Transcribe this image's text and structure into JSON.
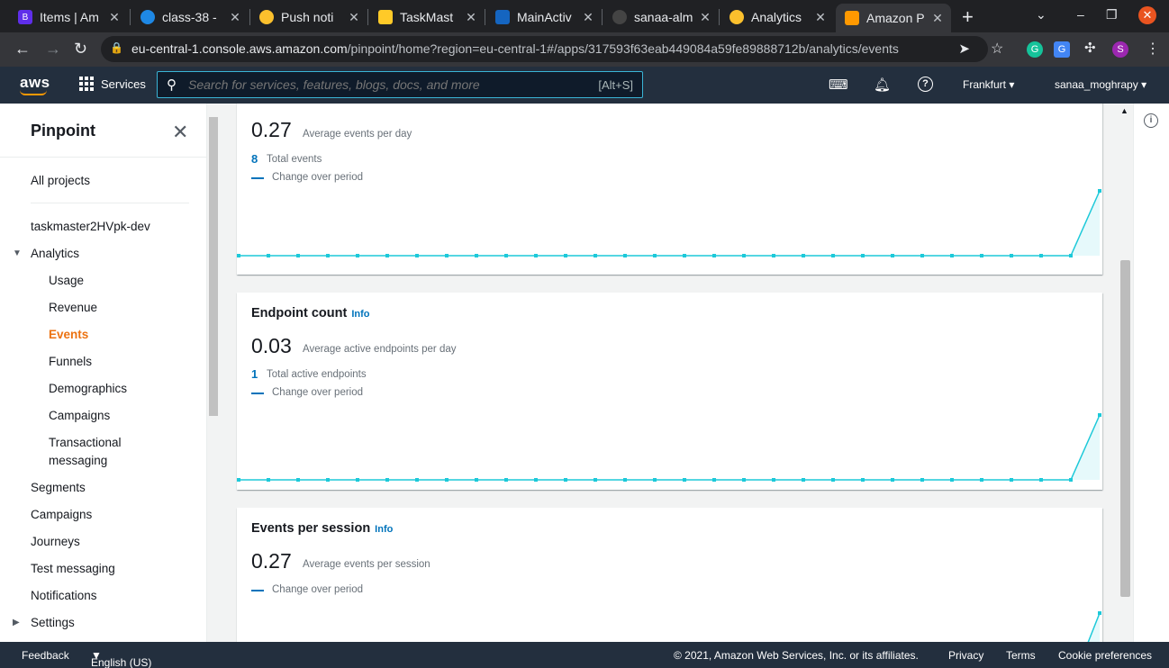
{
  "browser": {
    "tabs": [
      {
        "title": "Items | Am",
        "color": "#5f2eea"
      },
      {
        "title": "class-38 -",
        "color": "#1e88e5"
      },
      {
        "title": "Push noti",
        "color": "#fbc02d"
      },
      {
        "title": "TaskMast",
        "color": "#ffca28"
      },
      {
        "title": "MainActiv",
        "color": "#1565c0"
      },
      {
        "title": "sanaa-alm",
        "color": "#444444"
      },
      {
        "title": "Analytics",
        "color": "#fbc02d"
      },
      {
        "title": "Amazon P",
        "color": "#ff9900"
      }
    ],
    "new_tab": "+",
    "url_host": "eu-central-1.console.aws.amazon.com",
    "url_path": "/pinpoint/home?region=eu-central-1#/apps/317593f63eab449084a59fe89888712b/analytics/events",
    "profile_initial": "S"
  },
  "aws_nav": {
    "logo": "aws",
    "services_label": "Services",
    "search_placeholder": "Search for services, features, blogs, docs, and more",
    "search_shortcut": "[Alt+S]",
    "region": "Frankfurt",
    "user": "sanaa_moghrapy"
  },
  "sidebar": {
    "title": "Pinpoint",
    "all_projects": "All projects",
    "project": "taskmaster2HVpk-dev",
    "analytics": "Analytics",
    "analytics_items": [
      "Usage",
      "Revenue",
      "Events",
      "Funnels",
      "Demographics",
      "Campaigns",
      "Transactional",
      "messaging"
    ],
    "items": [
      "Segments",
      "Campaigns",
      "Journeys",
      "Test messaging",
      "Notifications"
    ],
    "settings": "Settings"
  },
  "cards": {
    "events": {
      "big_value": "0.27",
      "big_desc": "Average events per day",
      "small_value": "8",
      "small_desc": "Total events",
      "legend": "Change over period"
    },
    "endpoint": {
      "title": "Endpoint count",
      "info": "Info",
      "big_value": "0.03",
      "big_desc": "Average active endpoints per day",
      "small_value": "1",
      "small_desc": "Total active endpoints",
      "legend": "Change over period"
    },
    "session": {
      "title": "Events per session",
      "info": "Info",
      "big_value": "0.27",
      "big_desc": "Average events per session",
      "legend": "Change over period"
    }
  },
  "footer": {
    "feedback": "Feedback",
    "language": "English (US)",
    "copyright": "© 2021, Amazon Web Services, Inc. or its affiliates.",
    "privacy": "Privacy",
    "terms": "Terms",
    "cookies": "Cookie preferences"
  }
}
